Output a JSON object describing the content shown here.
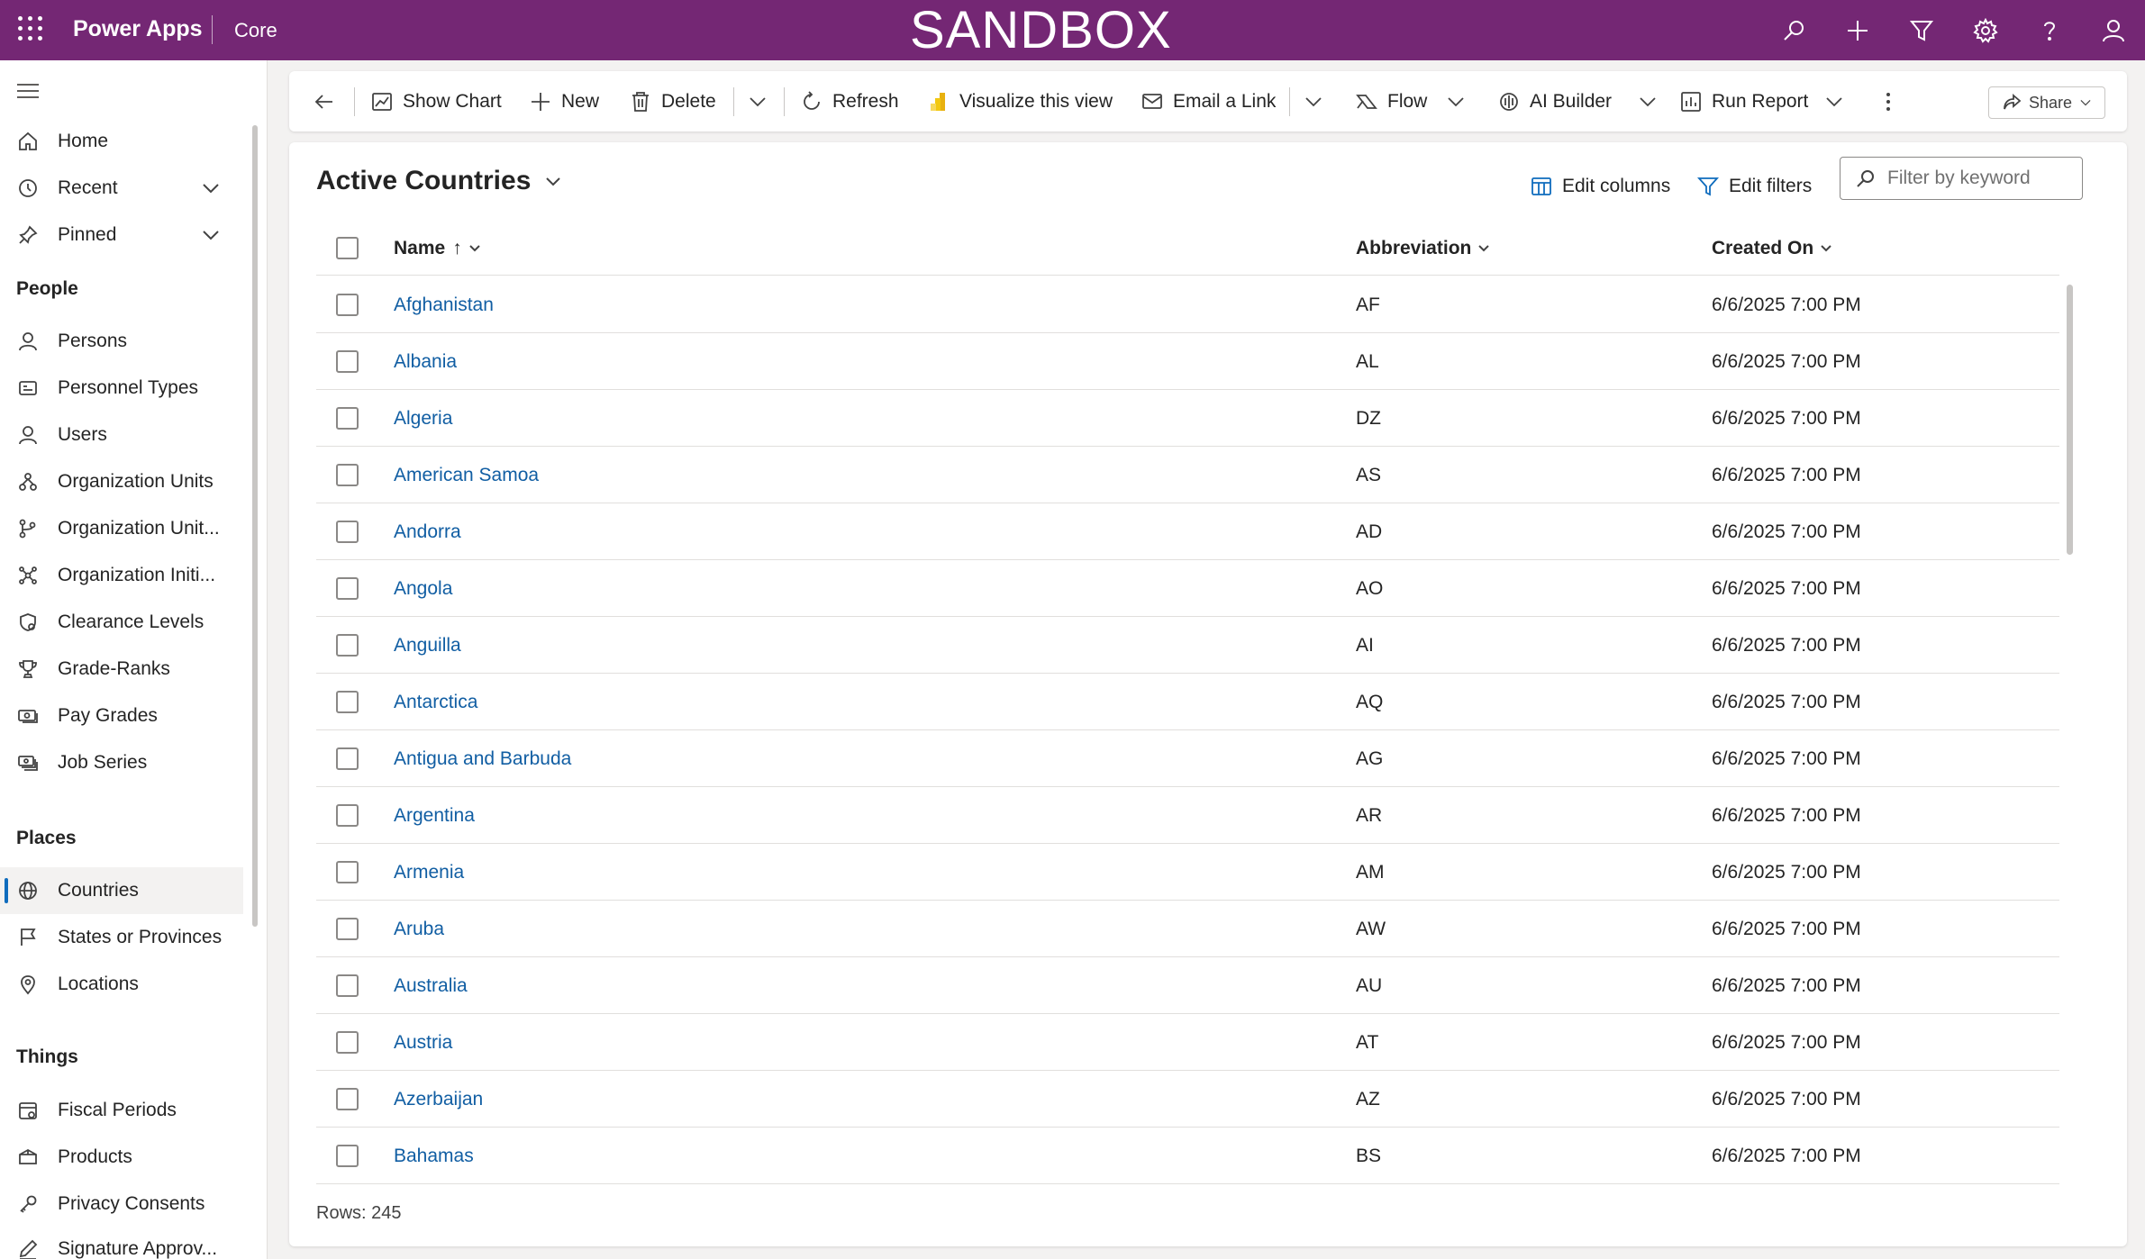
{
  "topbar": {
    "app_name": "Power Apps",
    "environment": "Core",
    "banner": "SANDBOX",
    "icons": [
      "search-icon",
      "plus-icon",
      "filter-icon",
      "gear-icon",
      "help-icon",
      "person-icon"
    ],
    "background": "#742774"
  },
  "sidebar": {
    "top_items": [
      {
        "label": "Home",
        "icon": "home-icon"
      },
      {
        "label": "Recent",
        "icon": "clock-icon"
      },
      {
        "label": "Pinned",
        "icon": "pin-icon"
      }
    ],
    "groups": [
      {
        "title": "People",
        "items": [
          {
            "label": "Persons",
            "icon": "person-icon"
          },
          {
            "label": "Personnel Types",
            "icon": "card-icon"
          },
          {
            "label": "Users",
            "icon": "person-icon"
          },
          {
            "label": "Organization Units",
            "icon": "org-icon"
          },
          {
            "label": "Organization Unit...",
            "icon": "branch-icon"
          },
          {
            "label": "Organization Initi...",
            "icon": "network-icon"
          },
          {
            "label": "Clearance Levels",
            "icon": "shield-icon"
          },
          {
            "label": "Grade-Ranks",
            "icon": "trophy-icon"
          },
          {
            "label": "Pay Grades",
            "icon": "money-icon"
          },
          {
            "label": "Job Series",
            "icon": "money-stack-icon"
          }
        ]
      },
      {
        "title": "Places",
        "items": [
          {
            "label": "Countries",
            "icon": "globe-icon",
            "selected": true
          },
          {
            "label": "States or Provinces",
            "icon": "flag-icon"
          },
          {
            "label": "Locations",
            "icon": "location-icon"
          }
        ]
      },
      {
        "title": "Things",
        "items": [
          {
            "label": "Fiscal Periods",
            "icon": "calendar-icon"
          },
          {
            "label": "Products",
            "icon": "box-icon"
          },
          {
            "label": "Privacy Consents",
            "icon": "key-icon"
          },
          {
            "label": "Signature Approv...",
            "icon": "signature-icon"
          }
        ]
      }
    ]
  },
  "commandbar": {
    "show_chart": "Show Chart",
    "new": "New",
    "delete": "Delete",
    "refresh": "Refresh",
    "visualize": "Visualize this view",
    "email_link": "Email a Link",
    "flow": "Flow",
    "ai_builder": "AI Builder",
    "run_report": "Run Report",
    "share": "Share"
  },
  "view": {
    "title": "Active Countries",
    "edit_columns": "Edit columns",
    "edit_filters": "Edit filters",
    "filter_placeholder": "Filter by keyword"
  },
  "grid": {
    "columns": [
      "Name",
      "Abbreviation",
      "Created On"
    ],
    "sort_indicator": "↑",
    "rows": [
      {
        "name": "Afghanistan",
        "abbr": "AF",
        "created": "6/6/2025 7:00 PM"
      },
      {
        "name": "Albania",
        "abbr": "AL",
        "created": "6/6/2025 7:00 PM"
      },
      {
        "name": "Algeria",
        "abbr": "DZ",
        "created": "6/6/2025 7:00 PM"
      },
      {
        "name": "American Samoa",
        "abbr": "AS",
        "created": "6/6/2025 7:00 PM"
      },
      {
        "name": "Andorra",
        "abbr": "AD",
        "created": "6/6/2025 7:00 PM"
      },
      {
        "name": "Angola",
        "abbr": "AO",
        "created": "6/6/2025 7:00 PM"
      },
      {
        "name": "Anguilla",
        "abbr": "AI",
        "created": "6/6/2025 7:00 PM"
      },
      {
        "name": "Antarctica",
        "abbr": "AQ",
        "created": "6/6/2025 7:00 PM"
      },
      {
        "name": "Antigua and Barbuda",
        "abbr": "AG",
        "created": "6/6/2025 7:00 PM"
      },
      {
        "name": "Argentina",
        "abbr": "AR",
        "created": "6/6/2025 7:00 PM"
      },
      {
        "name": "Armenia",
        "abbr": "AM",
        "created": "6/6/2025 7:00 PM"
      },
      {
        "name": "Aruba",
        "abbr": "AW",
        "created": "6/6/2025 7:00 PM"
      },
      {
        "name": "Australia",
        "abbr": "AU",
        "created": "6/6/2025 7:00 PM"
      },
      {
        "name": "Austria",
        "abbr": "AT",
        "created": "6/6/2025 7:00 PM"
      },
      {
        "name": "Azerbaijan",
        "abbr": "AZ",
        "created": "6/6/2025 7:00 PM"
      },
      {
        "name": "Bahamas",
        "abbr": "BS",
        "created": "6/6/2025 7:00 PM"
      }
    ],
    "footer": "Rows: 245"
  },
  "colors": {
    "accent": "#0f6cbd",
    "link": "#115ea3"
  }
}
